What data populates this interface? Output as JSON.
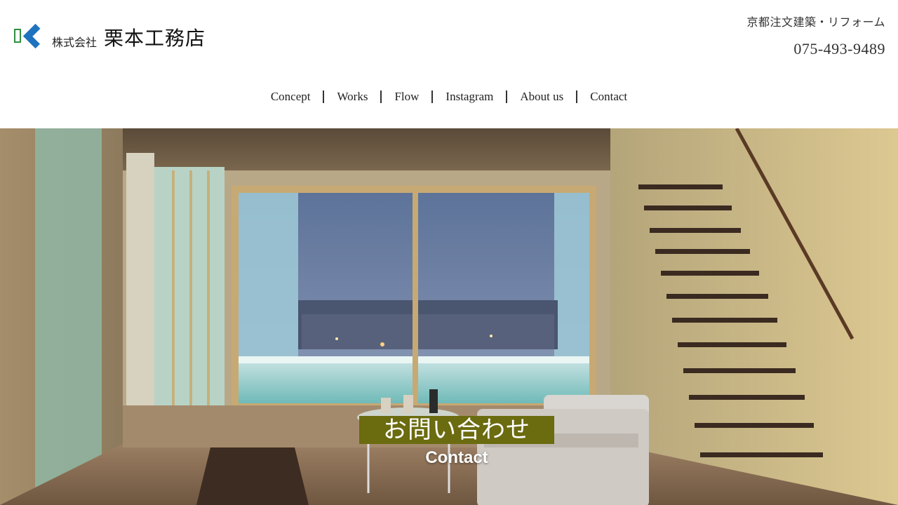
{
  "company": {
    "prefix": "株式会社",
    "name": "栗本工務店",
    "tagline": "京都注文建築・リフォーム",
    "phone": "075-493-9489"
  },
  "nav": {
    "items": [
      {
        "label": "Concept"
      },
      {
        "label": "Works"
      },
      {
        "label": "Flow"
      },
      {
        "label": "Instagram"
      },
      {
        "label": "About us"
      },
      {
        "label": "Contact"
      }
    ]
  },
  "hero": {
    "cta_jp": "お問い合わせ",
    "cta_en": "Contact",
    "colors": {
      "cta_bg": "#6b6b10"
    }
  }
}
